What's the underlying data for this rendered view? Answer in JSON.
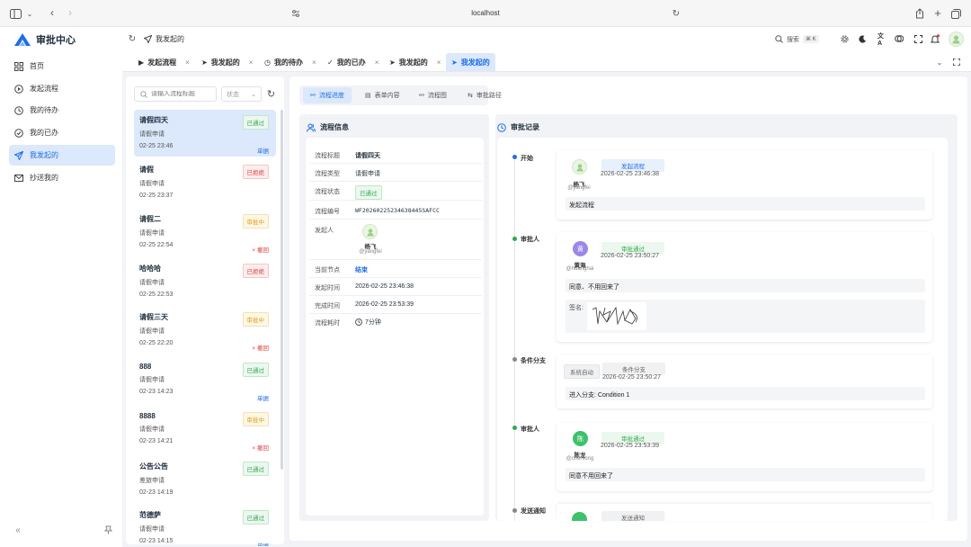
{
  "browser": {
    "url": "localhost"
  },
  "app": {
    "title": "审批中心"
  },
  "sidebar": {
    "items": [
      {
        "label": "首页"
      },
      {
        "label": "发起流程"
      },
      {
        "label": "我的待办"
      },
      {
        "label": "我的已办"
      },
      {
        "label": "我发起的"
      },
      {
        "label": "抄送我的"
      }
    ]
  },
  "header": {
    "breadcrumb": "我发起的",
    "search_label": "搜索",
    "search_shortcut": "⌘ K"
  },
  "tabs": [
    {
      "label": "发起流程"
    },
    {
      "label": "我发起的"
    },
    {
      "label": "我的待办"
    },
    {
      "label": "我的已办"
    },
    {
      "label": "我发起的"
    },
    {
      "label": "我发起的"
    }
  ],
  "list": {
    "search_placeholder": "请输入流程标题",
    "status_placeholder": "状态",
    "items": [
      {
        "title": "请假四天",
        "sub": "请假申请",
        "time": "02-25 23:46",
        "status": "已通过",
        "status_kind": "green",
        "action": "单据",
        "action_kind": "blue"
      },
      {
        "title": "请假",
        "sub": "请假申请",
        "time": "02-25 23:37",
        "status": "已拒绝",
        "status_kind": "red",
        "action": "",
        "action_kind": ""
      },
      {
        "title": "请假二",
        "sub": "请假申请",
        "time": "02-25 22:54",
        "status": "审批中",
        "status_kind": "yellow",
        "action": "× 撤回",
        "action_kind": "red"
      },
      {
        "title": "哈哈哈",
        "sub": "请假申请",
        "time": "02-25 22:53",
        "status": "已拒绝",
        "status_kind": "red",
        "action": "",
        "action_kind": ""
      },
      {
        "title": "请假三天",
        "sub": "请假申请",
        "time": "02-25 22:20",
        "status": "审批中",
        "status_kind": "yellow",
        "action": "× 撤回",
        "action_kind": "red"
      },
      {
        "title": "888",
        "sub": "请假申请",
        "time": "02-23 14:23",
        "status": "已通过",
        "status_kind": "green",
        "action": "单据",
        "action_kind": "blue"
      },
      {
        "title": "8888",
        "sub": "请假申请",
        "time": "02-23 14:21",
        "status": "审批中",
        "status_kind": "yellow",
        "action": "× 撤回",
        "action_kind": "red"
      },
      {
        "title": "公告公告",
        "sub": "差旅申请",
        "time": "02-23 14:19",
        "status": "已通过",
        "status_kind": "green",
        "action": "",
        "action_kind": ""
      },
      {
        "title": "范德萨",
        "sub": "请假申请",
        "time": "02-23 14:15",
        "status": "已通过",
        "status_kind": "green",
        "action": "单据",
        "action_kind": "blue"
      }
    ]
  },
  "detail_tabs": [
    {
      "label": "流程进度"
    },
    {
      "label": "表单内容"
    },
    {
      "label": "流程图"
    },
    {
      "label": "审批路径"
    }
  ],
  "info": {
    "heading": "流程信息",
    "rows": [
      {
        "label": "流程标题",
        "value": "请假四天"
      },
      {
        "label": "流程类型",
        "value": "请假申请"
      },
      {
        "label": "流程状态",
        "value": "已通过"
      },
      {
        "label": "流程编号",
        "value": "WF20260225234638445SAFCC"
      },
      {
        "label": "发起人",
        "value": ""
      },
      {
        "label": "当前节点",
        "value": "结束"
      },
      {
        "label": "发起时间",
        "value": "2026-02-25 23:46:38"
      },
      {
        "label": "完成时间",
        "value": "2026-02-25 23:53:39"
      },
      {
        "label": "流程耗时",
        "value": "7分钟"
      }
    ],
    "initiator_name": "杨飞",
    "initiator_handle": "@yangfei"
  },
  "records": {
    "heading": "审批记录",
    "nodes": [
      {
        "label": "开始",
        "user": "杨飞",
        "handle": "@yangfei",
        "avatar": "",
        "tag": "发起流程",
        "time": "2026-02-25 23:46:38",
        "message": "发起流程"
      },
      {
        "label": "审批人",
        "user": "黄海",
        "handle": "@huanghai",
        "avatar": "黄",
        "tag": "审批通过",
        "time": "2026-02-25 23:50:27",
        "message": "同意、不用回来了",
        "sign_label": "签名:"
      },
      {
        "label": "条件分支",
        "user": "系统自动",
        "tag": "条件分支",
        "time": "2026-02-25 23:50:27",
        "message": "进入分支: Condition 1"
      },
      {
        "label": "审批人",
        "user": "陈龙",
        "handle": "@chenlong",
        "avatar": "陈",
        "tag": "审批通过",
        "time": "2026-02-25 23:53:39",
        "message": "同意不用回来了"
      },
      {
        "label": "发送通知",
        "tag": "发送通知"
      }
    ]
  },
  "colors": {
    "accent": "#1e6ee8",
    "green": "#2eaa4e",
    "red": "#e23c3c",
    "yellow": "#e0a018"
  }
}
